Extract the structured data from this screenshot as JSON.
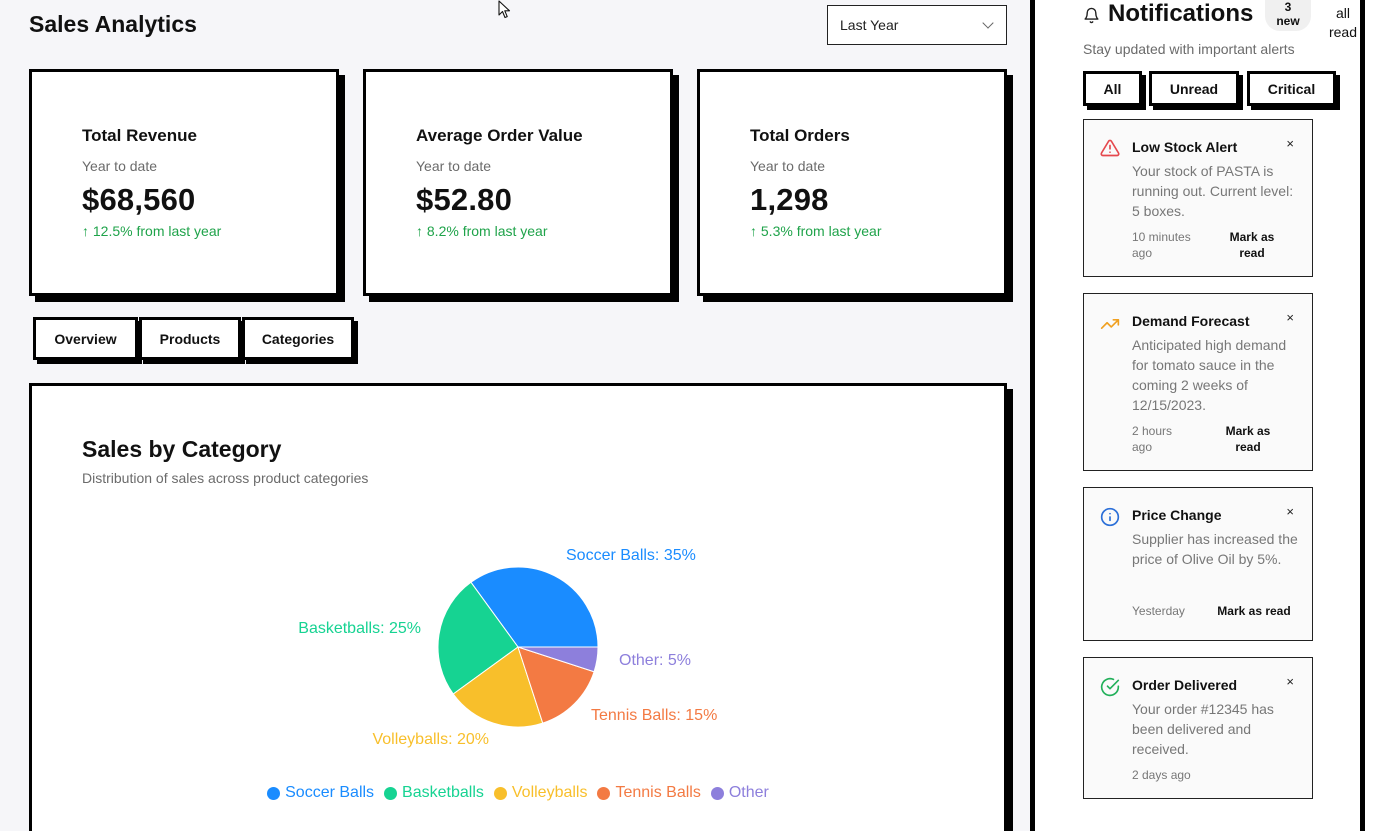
{
  "header": {
    "title": "Sales Analytics",
    "period": "Last Year"
  },
  "stats": [
    {
      "title": "Total Revenue",
      "subtitle": "Year to date",
      "value": "$68,560",
      "change": "↑ 12.5% from last year"
    },
    {
      "title": "Average Order Value",
      "subtitle": "Year to date",
      "value": "$52.80",
      "change": "↑ 8.2% from last year"
    },
    {
      "title": "Total Orders",
      "subtitle": "Year to date",
      "value": "1,298",
      "change": "↑ 5.3% from last year"
    }
  ],
  "tabs": [
    "Overview",
    "Products",
    "Categories"
  ],
  "chart_section": {
    "title": "Sales by Category",
    "description": "Distribution of sales across product categories"
  },
  "chart_data": {
    "type": "pie",
    "title": "Sales by Category",
    "slices": [
      {
        "label": "Soccer Balls",
        "value": 35,
        "color": "#1a8cff",
        "label_text": "Soccer Balls: 35%"
      },
      {
        "label": "Basketballs",
        "value": 25,
        "color": "#16d392",
        "label_text": "Basketballs: 25%"
      },
      {
        "label": "Volleyballs",
        "value": 20,
        "color": "#f8bf2b",
        "label_text": "Volleyballs: 20%"
      },
      {
        "label": "Tennis Balls",
        "value": 15,
        "color": "#f37a43",
        "label_text": "Tennis Balls: 15%"
      },
      {
        "label": "Other",
        "value": 5,
        "color": "#8d7fdc",
        "label_text": "Other: 5%"
      }
    ],
    "legend_position": "bottom"
  },
  "notifications": {
    "title": "Notifications",
    "badge": "3 new",
    "mark_all": "all read",
    "subtitle": "Stay updated with important alerts",
    "filters": [
      "All",
      "Unread",
      "Critical"
    ],
    "items": [
      {
        "icon": "warning-icon",
        "title": "Low Stock Alert",
        "message": "Your stock of PASTA is running out. Current level: 5 boxes.",
        "time": "10 minutes ago",
        "action": "Mark as read"
      },
      {
        "icon": "trending-up-icon",
        "title": "Demand Forecast",
        "message": "Anticipated high demand for tomato sauce in the coming 2 weeks of 12/15/2023.",
        "time": "2 hours ago",
        "action": "Mark as read"
      },
      {
        "icon": "info-icon",
        "title": "Price Change",
        "message": "Supplier has increased the price of Olive Oil by 5%.",
        "time": "Yesterday",
        "action": "Mark as read"
      },
      {
        "icon": "check-circle-icon",
        "title": "Order Delivered",
        "message": "Your order #12345 has been delivered and received.",
        "time": "2 days ago"
      }
    ],
    "close_glyph": "×"
  },
  "colors": {
    "positive": "#1fa34a",
    "warning": "#e5484d",
    "trend": "#f0a020",
    "info": "#2b6fd8",
    "success": "#22b05a"
  }
}
